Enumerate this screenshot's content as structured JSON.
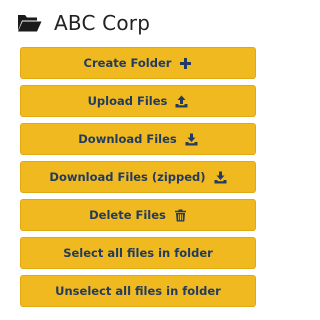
{
  "header": {
    "title": "ABC Corp",
    "icon": "folder-open-icon"
  },
  "colors": {
    "button_bg": "#f0b91f",
    "button_text": "#213b61",
    "title_text": "#222222"
  },
  "buttons": [
    {
      "label": "Create Folder",
      "icon": "plus-icon"
    },
    {
      "label": "Upload Files",
      "icon": "upload-icon"
    },
    {
      "label": "Download Files",
      "icon": "download-icon"
    },
    {
      "label": "Download Files (zipped)",
      "icon": "download-icon"
    },
    {
      "label": "Delete Files",
      "icon": "trash-icon"
    },
    {
      "label": "Select all files in folder",
      "icon": ""
    },
    {
      "label": "Unselect all files in folder",
      "icon": ""
    }
  ]
}
